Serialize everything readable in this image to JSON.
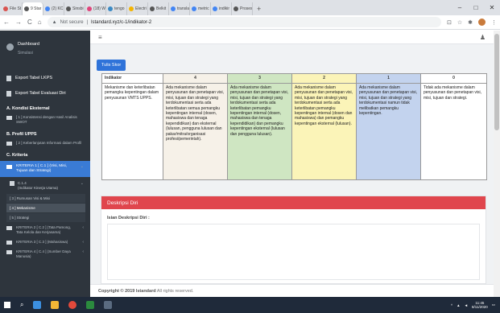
{
  "browser": {
    "tabs": [
      {
        "label": "File St",
        "color": "#d9534f"
      },
      {
        "label": "9 Star",
        "color": "#555555"
      },
      {
        "label": "(2) KC",
        "color": "#4285f4"
      },
      {
        "label": "Sinsbi",
        "color": "#555555"
      },
      {
        "label": "(18) W",
        "color": "#e0457b"
      },
      {
        "label": "tengo",
        "color": "#3b8ac4"
      },
      {
        "label": "Electri",
        "color": "#f4b400"
      },
      {
        "label": "Belkit",
        "color": "#555555"
      },
      {
        "label": "transla",
        "color": "#4285f4"
      },
      {
        "label": "metric",
        "color": "#4285f4"
      },
      {
        "label": "indikir",
        "color": "#4285f4"
      },
      {
        "label": "Proses",
        "color": "#555555"
      }
    ],
    "new_tab": "+",
    "security": "Not secure",
    "url": "lstandard.xyz/c-1/indikator-2"
  },
  "sidebar": {
    "user_title": "Dashboard",
    "user_sub": "Simulasi",
    "items": [
      {
        "label": "Export Tabel LKPS"
      },
      {
        "label": "Export Tabel Evaluasi Diri"
      }
    ],
    "kondisi_header": "A. Kondisi Eksternal",
    "kondisi_sub": "[ 1 ] Konsistensi dengan Hasil Analisis SWOT",
    "profil_header": "B. Profil UPPS",
    "profil_sub": "[ 2 ] Keberlanjutan Informasi dalam Profil",
    "kriteria_header": "C. Kriteria",
    "kriteria_active": "KRITERIA 1 [ C.1 ] (Visi, Misi, Tujuan dan Strategi)",
    "c14": "C.1.4",
    "c14_sub": "(Indikator Kinerja Utama)",
    "leaves": [
      {
        "label": "[ 3 ] Rumusan Visi & Misi",
        "selected": false
      },
      {
        "label": "[ 4 ] Mekanisme",
        "selected": true
      },
      {
        "label": "[ 5 ] Strategi",
        "selected": false
      }
    ],
    "kriteria2": "KRITERIA 2 [ C.2 ] (Tata Pamong, Tata Kelola dan Kerjasama)",
    "kriteria3": "KRITERIA 3 [ C.3 ] (Mahasiswa)",
    "kriteria4": "KRITERIA 4 [ C.4 ] (Sumber Daya Manusia)"
  },
  "main": {
    "hamburger": "≡",
    "user_icon": "♟",
    "tulis_skor": "Tulis Skor",
    "table": {
      "headers": [
        "Indikator",
        "4",
        "3",
        "2",
        "1",
        "0"
      ],
      "cells": [
        "Mekanisme dan keterlibatan pemangku kepentingan dalam penyusunan VMTS UPPS.",
        "Ada mekanisme dalam penyusunan dan penetapan visi, misi, tujuan dan strategi yang terdokumentasi serta ada keterlibatan semua pemangku kepentingan internal (dosen, mahasiswa dan tenaga kependidikan) dan eksternal (lulusan, pengguna lulusan dan pakar/mitra/organisasi profesi/pemerintah).",
        "Ada mekanisme dalam penyusunan dan penetapan visi, misi, tujuan dan strategi yang terdokumentasi serta ada keterlibatan pemangku kepentingan internal (dosen, mahasiswa dan tenaga kependidikan) dan pemangku kepentingan eksternal (lulusan dan pengguna lulusan).",
        "Ada mekanisme dalam penyusunan dan penetapan visi, misi, tujuan dan strategi yang terdokumentasi serta ada keterlibatan pemangku kepentingan internal (dosen dan mahasiswa) dan pemangku kepentingan eksternal (lulusan).",
        "Ada mekanisme dalam penyusunan dan penetapan visi, misi, tujuan dan strategi yang terdokumentasi namun tidak melibatkan pemangku kepentingan.",
        "Tidak ada mekanisme dalam penyusunan dan penetapan visi, misi, tujuan dan strategi."
      ]
    },
    "panel_title": "Deskripsi Diri",
    "panel_label": "Isian Deskripsi Diri :",
    "footer_prefix": "Copyright © 2019 lstandard",
    "footer_suffix": "All rights reserved."
  },
  "taskbar": {
    "time": "11:45",
    "date": "8/11/2020"
  }
}
